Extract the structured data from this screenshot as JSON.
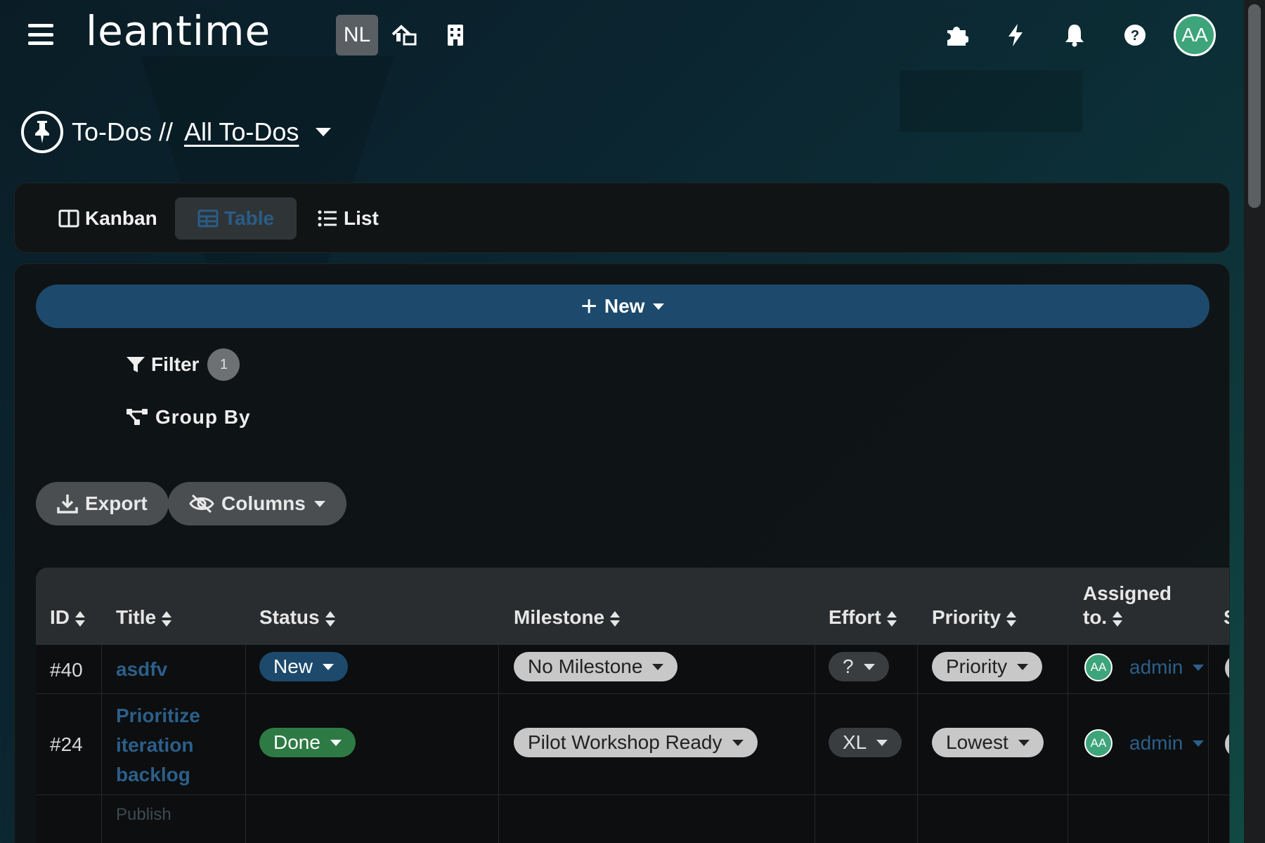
{
  "header": {
    "logo_text": "leantime",
    "project_initials": "NL",
    "user_initials": "AA",
    "icons": [
      "menu-icon",
      "home-swap-icon",
      "building-icon",
      "puzzle-icon",
      "bolt-icon",
      "bell-icon",
      "help-icon"
    ]
  },
  "breadcrumb": {
    "section": "To-Dos //",
    "view": "All To-Dos"
  },
  "view_tabs": [
    {
      "label": "Kanban",
      "icon": "kanban-icon",
      "active": false
    },
    {
      "label": "Table",
      "icon": "table-icon",
      "active": true
    },
    {
      "label": "List",
      "icon": "list-icon",
      "active": false
    }
  ],
  "toolbar": {
    "new_label": "New",
    "filter_label": "Filter",
    "filter_count": "1",
    "group_by_label": "Group By",
    "export_label": "Export",
    "columns_label": "Columns"
  },
  "table": {
    "headers": {
      "id": "ID",
      "title": "Title",
      "status": "Status",
      "milestone": "Milestone",
      "effort": "Effort",
      "priority": "Priority",
      "assigned_line1": "Assigned",
      "assigned_line2": "to.",
      "next": "S"
    },
    "rows": [
      {
        "id": "#40",
        "title": "asdfv",
        "status": "New",
        "milestone": "No Milestone",
        "effort": "?",
        "priority": "Priority",
        "assignee_initials": "AA",
        "assignee": "admin"
      },
      {
        "id": "#24",
        "title_lines": [
          "Prioritize",
          "iteration",
          "backlog"
        ],
        "status": "Done",
        "milestone": "Pilot Workshop Ready",
        "effort": "XL",
        "priority": "Lowest",
        "assignee_initials": "AA",
        "assignee": "admin"
      },
      {
        "title_partial": "Publish"
      }
    ]
  },
  "colors": {
    "accent_blue": "#1d4a6c",
    "done_green": "#2e7a44",
    "avatar_green": "#3ea47a",
    "link_blue": "#2c5f8a"
  }
}
